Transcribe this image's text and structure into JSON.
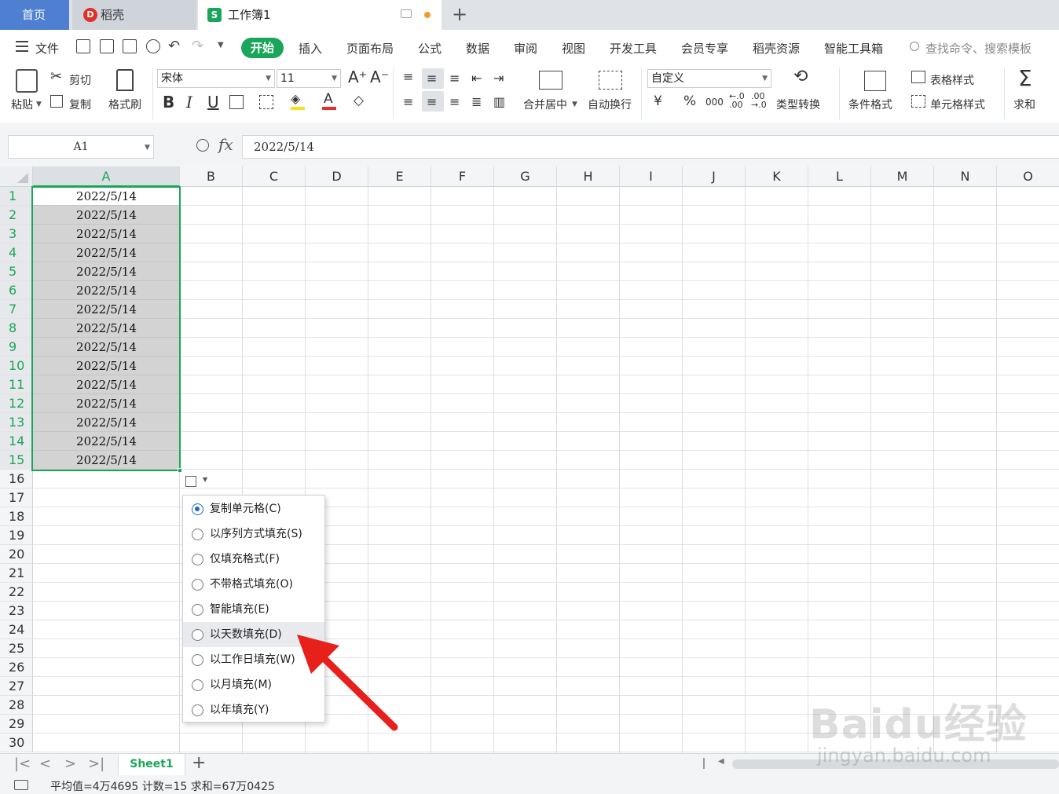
{
  "tabs": {
    "home": "首页",
    "daoke": "稻壳",
    "daoke_logo": "D",
    "workbook": "工作簿1",
    "workbook_logo": "S",
    "new_tab": "+"
  },
  "menu": {
    "file": "文件",
    "items": [
      "开始",
      "插入",
      "页面布局",
      "公式",
      "数据",
      "审阅",
      "视图",
      "开发工具",
      "会员专享",
      "稻壳资源",
      "智能工具箱"
    ],
    "search": "查找命令、搜索模板"
  },
  "toolbar": {
    "paste": "粘贴",
    "cut": "剪切",
    "copy": "复制",
    "format_painter": "格式刷",
    "font_name": "宋体",
    "font_size": "11",
    "bold": "B",
    "italic": "I",
    "underline": "U",
    "merge_center": "合并居中",
    "wrap_text": "自动换行",
    "number_format": "自定义",
    "currency": "¥",
    "percent": "%",
    "thousands": "000",
    "type_convert": "类型转换",
    "cond_format": "条件格式",
    "table_style": "表格样式",
    "cell_style": "单元格样式",
    "sum": "求和"
  },
  "formula_bar": {
    "name_box": "A1",
    "fx": "fx",
    "value": "2022/5/14"
  },
  "grid": {
    "columns": [
      "A",
      "B",
      "C",
      "D",
      "E",
      "F",
      "G",
      "H",
      "I",
      "J",
      "K",
      "L",
      "M",
      "N",
      "O"
    ],
    "rows": [
      "1",
      "2",
      "3",
      "4",
      "5",
      "6",
      "7",
      "8",
      "9",
      "10",
      "11",
      "12",
      "13",
      "14",
      "15",
      "16",
      "17",
      "18",
      "19",
      "20",
      "21",
      "22",
      "23",
      "24",
      "25",
      "26",
      "27",
      "28",
      "29",
      "30"
    ],
    "colA_values": [
      "2022/5/14",
      "2022/5/14",
      "2022/5/14",
      "2022/5/14",
      "2022/5/14",
      "2022/5/14",
      "2022/5/14",
      "2022/5/14",
      "2022/5/14",
      "2022/5/14",
      "2022/5/14",
      "2022/5/14",
      "2022/5/14",
      "2022/5/14",
      "2022/5/14"
    ]
  },
  "autofill_menu": {
    "options": [
      {
        "label": "复制单元格(C)",
        "selected": true
      },
      {
        "label": "以序列方式填充(S)",
        "selected": false
      },
      {
        "label": "仅填充格式(F)",
        "selected": false
      },
      {
        "label": "不带格式填充(O)",
        "selected": false
      },
      {
        "label": "智能填充(E)",
        "selected": false
      },
      {
        "label": "以天数填充(D)",
        "selected": false
      },
      {
        "label": "以工作日填充(W)",
        "selected": false
      },
      {
        "label": "以月填充(M)",
        "selected": false
      },
      {
        "label": "以年填充(Y)",
        "selected": false
      }
    ]
  },
  "sheets": {
    "active": "Sheet1",
    "add": "+"
  },
  "status": {
    "text": "平均值=4万4695  计数=15  求和=67万0425"
  },
  "watermark": {
    "brand": "Baidu经验",
    "url": "jingyan.baidu.com"
  },
  "colors": {
    "accent_green": "#1aa65a",
    "home_tab_blue": "#4e7fd0",
    "arrow_red": "#e8201c"
  }
}
